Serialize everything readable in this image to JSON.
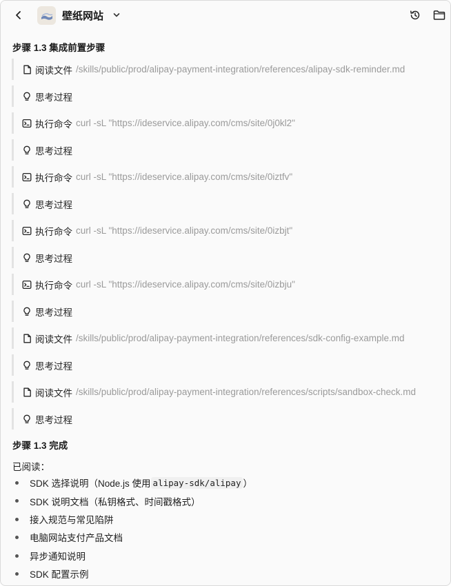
{
  "header": {
    "title": "壁纸网站"
  },
  "sections": {
    "step_title": "步骤 1.3 集成前置步骤",
    "done_title": "步骤 1.3 完成",
    "read_label": "已阅读："
  },
  "steps": [
    {
      "type": "file",
      "label": "阅读文件",
      "detail": "/skills/public/prod/alipay-payment-integration/references/alipay-sdk-reminder.md"
    },
    {
      "type": "thought",
      "label": "思考过程",
      "detail": ""
    },
    {
      "type": "command",
      "label": "执行命令",
      "detail": "curl -sL \"https://ideservice.alipay.com/cms/site/0j0kl2\""
    },
    {
      "type": "thought",
      "label": "思考过程",
      "detail": ""
    },
    {
      "type": "command",
      "label": "执行命令",
      "detail": "curl -sL \"https://ideservice.alipay.com/cms/site/0iztfv\""
    },
    {
      "type": "thought",
      "label": "思考过程",
      "detail": ""
    },
    {
      "type": "command",
      "label": "执行命令",
      "detail": "curl -sL \"https://ideservice.alipay.com/cms/site/0izbjt\""
    },
    {
      "type": "thought",
      "label": "思考过程",
      "detail": ""
    },
    {
      "type": "command",
      "label": "执行命令",
      "detail": "curl -sL \"https://ideservice.alipay.com/cms/site/0izbju\""
    },
    {
      "type": "thought",
      "label": "思考过程",
      "detail": ""
    },
    {
      "type": "file",
      "label": "阅读文件",
      "detail": "/skills/public/prod/alipay-payment-integration/references/sdk-config-example.md"
    },
    {
      "type": "thought",
      "label": "思考过程",
      "detail": ""
    },
    {
      "type": "file",
      "label": "阅读文件",
      "detail": "/skills/public/prod/alipay-payment-integration/references/scripts/sandbox-check.md"
    },
    {
      "type": "thought",
      "label": "思考过程",
      "detail": ""
    }
  ],
  "read_items": [
    {
      "before": "SDK 选择说明（Node.js 使用 ",
      "code": "alipay-sdk/alipay",
      "after": "）"
    },
    {
      "before": "SDK 说明文档（私钥格式、时间戳格式）",
      "code": "",
      "after": ""
    },
    {
      "before": "接入规范与常见陷阱",
      "code": "",
      "after": ""
    },
    {
      "before": "电脑网站支付产品文档",
      "code": "",
      "after": ""
    },
    {
      "before": "异步通知说明",
      "code": "",
      "after": ""
    },
    {
      "before": "SDK 配置示例",
      "code": "",
      "after": ""
    }
  ],
  "icons": {
    "back": "chevron-left-icon",
    "app": "app-logo-icon",
    "dropdown": "chevron-down-icon",
    "history": "history-icon",
    "folder": "folder-icon",
    "file": "file-icon",
    "thought": "lightbulb-icon",
    "command": "terminal-icon"
  }
}
